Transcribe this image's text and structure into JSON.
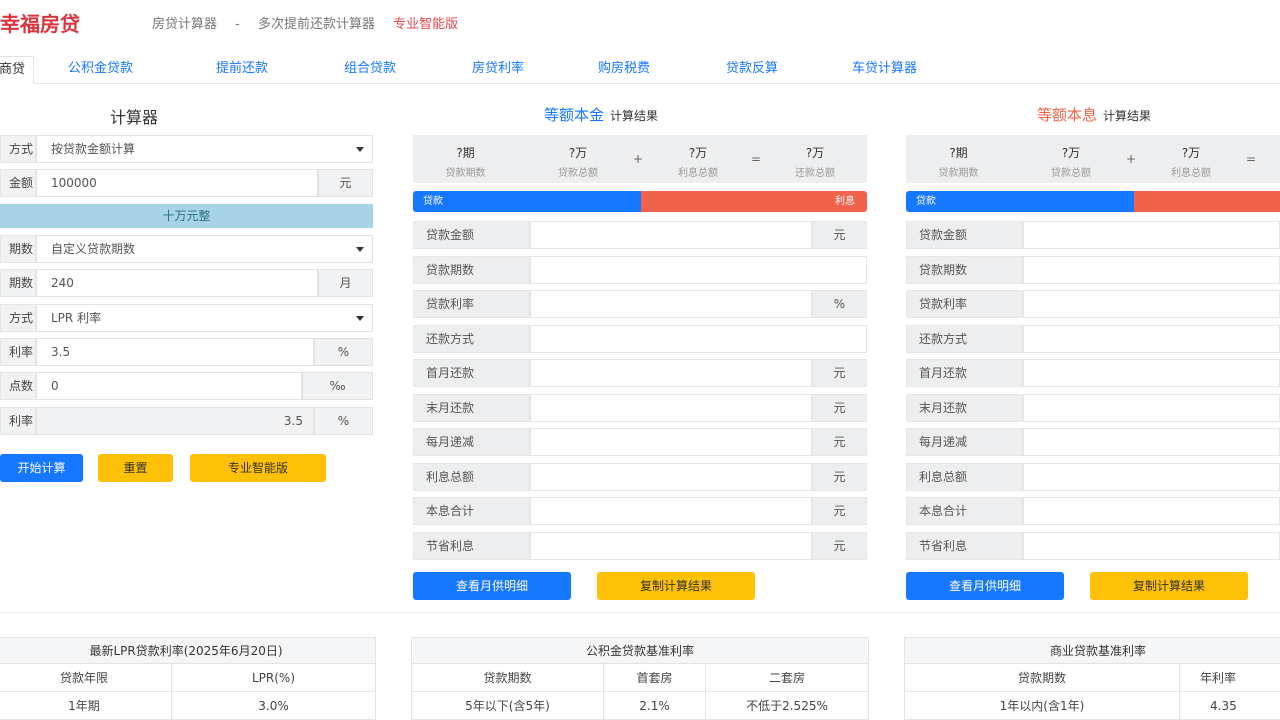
{
  "header": {
    "logo": "幸福房贷",
    "breadcrumbs": [
      "房贷计算器",
      "-",
      "多次提前还款计算器",
      "专业智能版"
    ]
  },
  "tabs": [
    {
      "label": "商贷",
      "active": true
    },
    {
      "label": "公积金贷款",
      "active": false
    },
    {
      "label": "提前还款",
      "active": false
    },
    {
      "label": "组合贷款",
      "active": false
    },
    {
      "label": "房贷利率",
      "active": false
    },
    {
      "label": "购房税费",
      "active": false
    },
    {
      "label": "贷款反算",
      "active": false
    },
    {
      "label": "车贷计算器",
      "active": false
    }
  ],
  "calculator": {
    "title": "计算器",
    "rows": {
      "method": {
        "label": "方式",
        "value": "按贷款金额计算"
      },
      "amount": {
        "label": "金额",
        "value": "100000",
        "unit": "元"
      },
      "amount_hint": "十万元整",
      "term_type": {
        "label": "期数",
        "value": "自定义贷款期数"
      },
      "term": {
        "label": "期数",
        "value": "240",
        "unit": "月"
      },
      "rate_type": {
        "label": "方式",
        "value": "LPR 利率"
      },
      "rate": {
        "label": "利率",
        "value": "3.5",
        "unit": "%"
      },
      "bp": {
        "label": "点数",
        "value": "0",
        "unit": "‰"
      },
      "final_rate": {
        "label": "利率",
        "value": "3.5",
        "unit": "%"
      }
    },
    "buttons": {
      "calc": "开始计算",
      "reset": "重置",
      "pro": "专业智能版"
    }
  },
  "panels": [
    {
      "title": "等额本金",
      "title_color": "#1677ff",
      "subtitle": "计算结果",
      "summary": [
        {
          "value": "?期",
          "label": "贷款期数"
        },
        {
          "value": "?万",
          "label": "贷款总额"
        },
        {
          "value": "?万",
          "label": "利息总额"
        },
        {
          "value": "?万",
          "label": "还款总额"
        }
      ],
      "ops": [
        "+",
        "="
      ],
      "ratio": {
        "principal_label": "贷款",
        "interest_label": "利息",
        "principal_fraction": 0.5
      },
      "rows": [
        {
          "label": "贷款金额",
          "unit": "元"
        },
        {
          "label": "贷款期数",
          "unit": ""
        },
        {
          "label": "贷款利率",
          "unit": "%"
        },
        {
          "label": "还款方式",
          "unit": ""
        },
        {
          "label": "首月还款",
          "unit": "元"
        },
        {
          "label": "末月还款",
          "unit": "元"
        },
        {
          "label": "每月递减",
          "unit": "元"
        },
        {
          "label": "利息总额",
          "unit": "元"
        },
        {
          "label": "本息合计",
          "unit": "元"
        },
        {
          "label": "节省利息",
          "unit": "元"
        }
      ],
      "buttons": {
        "detail": "查看月供明细",
        "copy": "复制计算结果"
      }
    },
    {
      "title": "等额本息",
      "title_color": "#f0634a",
      "subtitle": "计算结果",
      "summary": [
        {
          "value": "?期",
          "label": "贷款期数"
        },
        {
          "value": "?万",
          "label": "贷款总额"
        },
        {
          "value": "?万",
          "label": "利息总额"
        }
      ],
      "ops": [
        "+",
        "="
      ],
      "ratio": {
        "principal_label": "贷款",
        "interest_label": "",
        "principal_fraction": 0.5
      },
      "rows": [
        {
          "label": "贷款金额",
          "unit": ""
        },
        {
          "label": "贷款期数",
          "unit": ""
        },
        {
          "label": "贷款利率",
          "unit": ""
        },
        {
          "label": "还款方式",
          "unit": ""
        },
        {
          "label": "首月还款",
          "unit": ""
        },
        {
          "label": "末月还款",
          "unit": ""
        },
        {
          "label": "每月递减",
          "unit": ""
        },
        {
          "label": "利息总额",
          "unit": ""
        },
        {
          "label": "本息合计",
          "unit": ""
        },
        {
          "label": "节省利息",
          "unit": ""
        }
      ],
      "buttons": {
        "detail": "查看月供明细",
        "copy": "复制计算结果"
      }
    }
  ],
  "tables": {
    "lpr": {
      "title": "最新LPR贷款利率(2025年6月20日)",
      "headers": [
        "贷款年限",
        "LPR(%)"
      ],
      "row": [
        "1年期",
        "3.0%"
      ]
    },
    "fund": {
      "title": "公积金贷款基准利率",
      "headers": [
        "贷款期数",
        "首套房",
        "二套房"
      ],
      "row": [
        "5年以下(含5年)",
        "2.1%",
        "不低于2.525%"
      ]
    },
    "commercial": {
      "title": "商业贷款基准利率",
      "headers": [
        "贷款期数",
        "年利率"
      ],
      "row": [
        "1年以内(含1年)",
        "4.35"
      ]
    }
  },
  "colors": {
    "accent": "#1677ff",
    "warn": "#ffc107",
    "interest": "#f0634a",
    "brand": "#d9363e"
  }
}
